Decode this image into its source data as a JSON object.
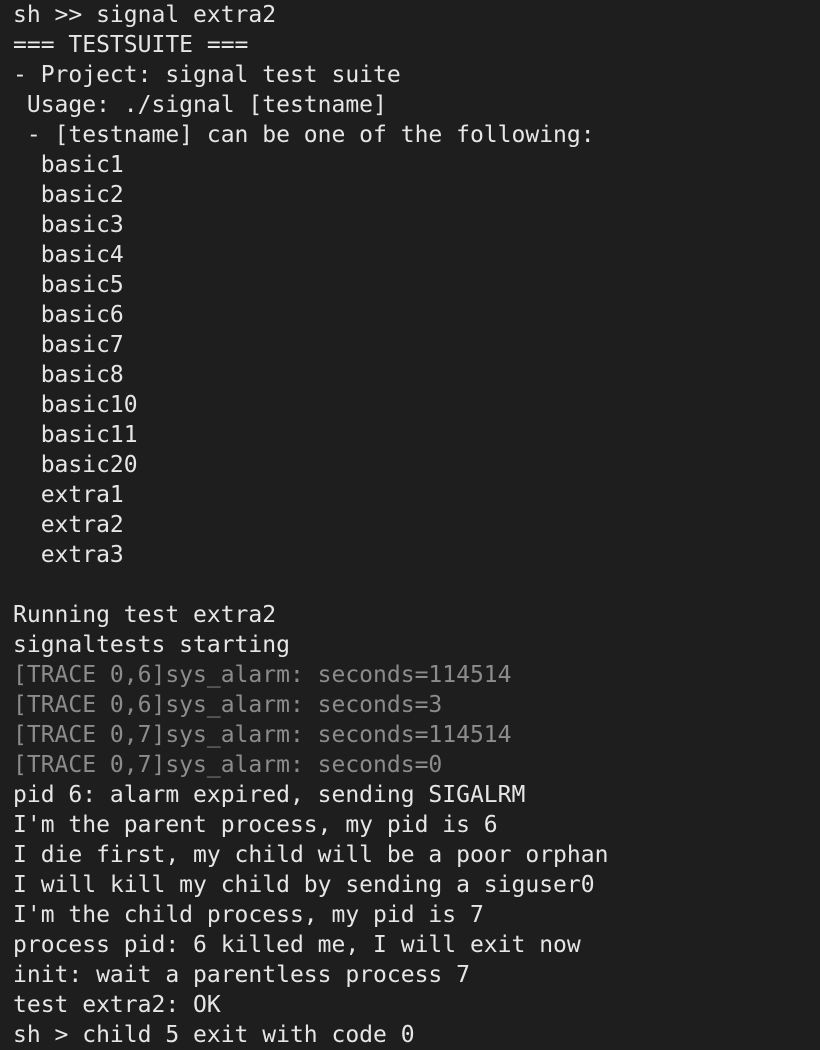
{
  "terminal": {
    "colors": {
      "background": "#1e1e1e",
      "text": "#e6e6e6",
      "trace": "#8c8c8c"
    },
    "lines": [
      {
        "text": "sh >> signal extra2",
        "kind": "normal"
      },
      {
        "text": "=== TESTSUITE ===",
        "kind": "normal"
      },
      {
        "text": "- Project: signal test suite",
        "kind": "normal"
      },
      {
        "text": " Usage: ./signal [testname]",
        "kind": "normal"
      },
      {
        "text": " - [testname] can be one of the following:",
        "kind": "normal"
      },
      {
        "text": "  basic1",
        "kind": "normal"
      },
      {
        "text": "  basic2",
        "kind": "normal"
      },
      {
        "text": "  basic3",
        "kind": "normal"
      },
      {
        "text": "  basic4",
        "kind": "normal"
      },
      {
        "text": "  basic5",
        "kind": "normal"
      },
      {
        "text": "  basic6",
        "kind": "normal"
      },
      {
        "text": "  basic7",
        "kind": "normal"
      },
      {
        "text": "  basic8",
        "kind": "normal"
      },
      {
        "text": "  basic10",
        "kind": "normal"
      },
      {
        "text": "  basic11",
        "kind": "normal"
      },
      {
        "text": "  basic20",
        "kind": "normal"
      },
      {
        "text": "  extra1",
        "kind": "normal"
      },
      {
        "text": "  extra2",
        "kind": "normal"
      },
      {
        "text": "  extra3",
        "kind": "normal"
      },
      {
        "text": "",
        "kind": "normal"
      },
      {
        "text": "Running test extra2",
        "kind": "normal"
      },
      {
        "text": "signaltests starting",
        "kind": "normal"
      },
      {
        "text": "[TRACE 0,6]sys_alarm: seconds=114514",
        "kind": "trace"
      },
      {
        "text": "[TRACE 0,6]sys_alarm: seconds=3",
        "kind": "trace"
      },
      {
        "text": "[TRACE 0,7]sys_alarm: seconds=114514",
        "kind": "trace"
      },
      {
        "text": "[TRACE 0,7]sys_alarm: seconds=0",
        "kind": "trace"
      },
      {
        "text": "pid 6: alarm expired, sending SIGALRM",
        "kind": "normal"
      },
      {
        "text": "I'm the parent process, my pid is 6",
        "kind": "normal"
      },
      {
        "text": "I die first, my child will be a poor orphan",
        "kind": "normal"
      },
      {
        "text": "I will kill my child by sending a siguser0",
        "kind": "normal"
      },
      {
        "text": "I'm the child process, my pid is 7",
        "kind": "normal"
      },
      {
        "text": "process pid: 6 killed me, I will exit now",
        "kind": "normal"
      },
      {
        "text": "init: wait a parentless process 7",
        "kind": "normal"
      },
      {
        "text": "test extra2: OK",
        "kind": "normal"
      },
      {
        "text": "sh > child 5 exit with code 0",
        "kind": "normal"
      }
    ]
  }
}
